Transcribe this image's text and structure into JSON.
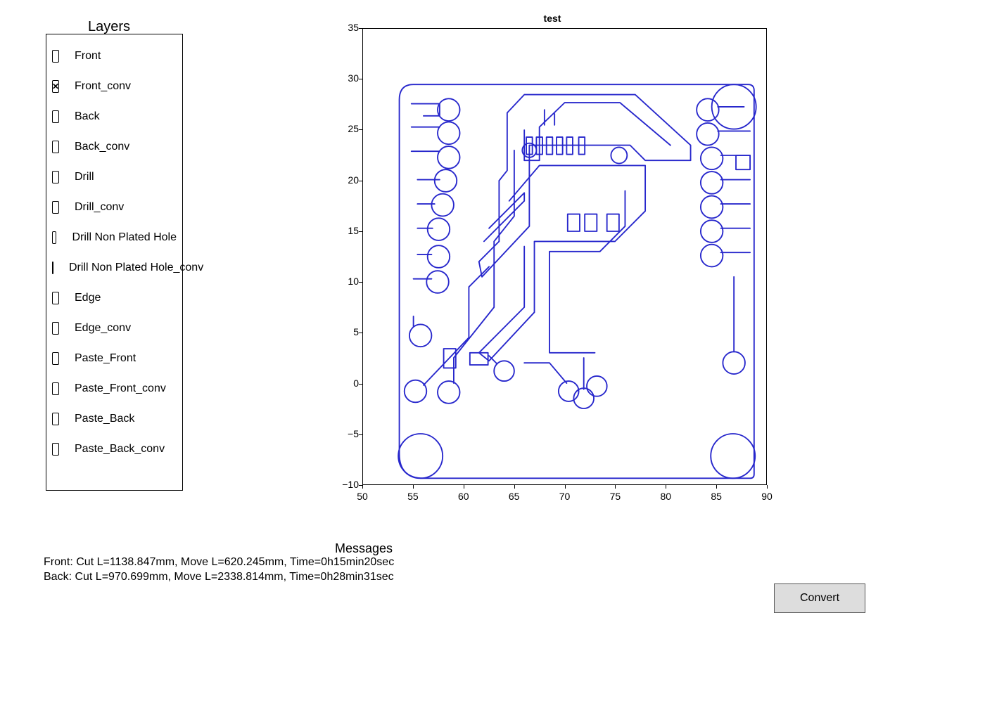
{
  "layers_title": "Layers",
  "layers": [
    {
      "name": "Front",
      "checked": false
    },
    {
      "name": "Front_conv",
      "checked": true
    },
    {
      "name": "Back",
      "checked": false
    },
    {
      "name": "Back_conv",
      "checked": false
    },
    {
      "name": "Drill",
      "checked": false
    },
    {
      "name": "Drill_conv",
      "checked": false
    },
    {
      "name": "Drill Non Plated Hole",
      "checked": false
    },
    {
      "name": "Drill Non Plated Hole_conv",
      "checked": false
    },
    {
      "name": "Edge",
      "checked": false
    },
    {
      "name": "Edge_conv",
      "checked": false
    },
    {
      "name": "Paste_Front",
      "checked": false
    },
    {
      "name": "Paste_Front_conv",
      "checked": false
    },
    {
      "name": "Paste_Back",
      "checked": false
    },
    {
      "name": "Paste_Back_conv",
      "checked": false
    }
  ],
  "plot": {
    "title": "test",
    "x_ticks": [
      "50",
      "55",
      "60",
      "65",
      "70",
      "75",
      "80",
      "85",
      "90"
    ],
    "y_ticks": [
      "−10",
      "−5",
      "0",
      "5",
      "10",
      "15",
      "20",
      "25",
      "30",
      "35"
    ]
  },
  "chart_data": {
    "type": "line",
    "title": "test",
    "xlabel": "",
    "ylabel": "",
    "xlim": [
      50,
      90
    ],
    "ylim": [
      -10,
      35
    ],
    "description": "PCB toolpath/gerber outline for layer Front_conv, rendered in blue. Shows board outline roughly from x=53..89, y=-9..30, with mounting-hole circles at each corner, J-shaped pad outlines along the left edge and right edge, internal trace contours and small rectangular pad outlines in the center/upper region."
  },
  "messages_title": "Messages",
  "messages_lines": [
    "Front: Cut L=1138.847mm, Move L=620.245mm, Time=0h15min20sec",
    "Back: Cut L=970.699mm, Move L=2338.814mm, Time=0h28min31sec"
  ],
  "convert_button_label": "Convert"
}
